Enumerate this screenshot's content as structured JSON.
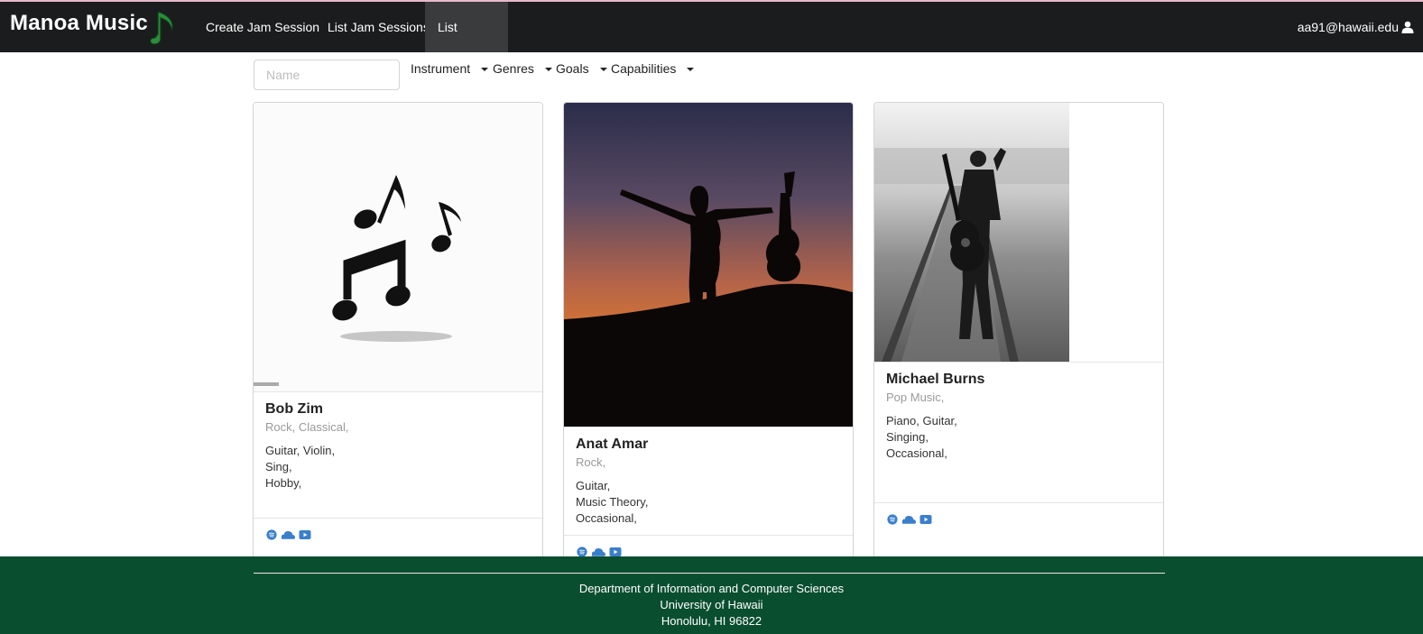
{
  "navbar": {
    "brand": "Manoa Music",
    "items": [
      {
        "label": "Create Jam Session"
      },
      {
        "label": "List Jam Sessions"
      },
      {
        "label": "List Profiles"
      }
    ],
    "active_item": "List Profiles",
    "user": "aa91@hawaii.edu",
    "colors": {
      "background": "#1b1c1d",
      "brand_icon": "#2e8b3c"
    }
  },
  "filters": {
    "name_placeholder": "Name",
    "dropdowns": [
      {
        "label": "Instrument"
      },
      {
        "label": "Genres"
      },
      {
        "label": "Goals"
      },
      {
        "label": "Capabilities"
      }
    ]
  },
  "profiles": [
    {
      "name": "Bob Zim",
      "genres": "Rock, Classical,",
      "instruments": "Guitar, Violin,",
      "capabilities": "Sing,",
      "goals": "Hobby,",
      "image": "music-notes-icon",
      "links": [
        "spotify-icon",
        "soundcloud-icon",
        "youtube-icon"
      ]
    },
    {
      "name": "Anat Amar",
      "genres": "Rock,",
      "instruments": "Guitar,",
      "capabilities": "Music Theory,",
      "goals": "Occasional,",
      "image": "sunset-guitar-silhouette",
      "links": [
        "spotify-icon",
        "soundcloud-icon",
        "youtube-icon"
      ]
    },
    {
      "name": "Michael Burns",
      "genres": "Pop Music,",
      "instruments": "Piano, Guitar,",
      "capabilities": "Singing,",
      "goals": "Occasional,",
      "image": "railway-guitar-photo",
      "links": [
        "spotify-icon",
        "soundcloud-icon",
        "youtube-icon"
      ]
    }
  ],
  "footer": {
    "line1": "Department of Information and Computer Sciences",
    "line2": "University of Hawaii",
    "line3": "Honolulu, HI 96822",
    "background": "#0a4e30"
  },
  "link_icon_color": "#3a7fcb"
}
